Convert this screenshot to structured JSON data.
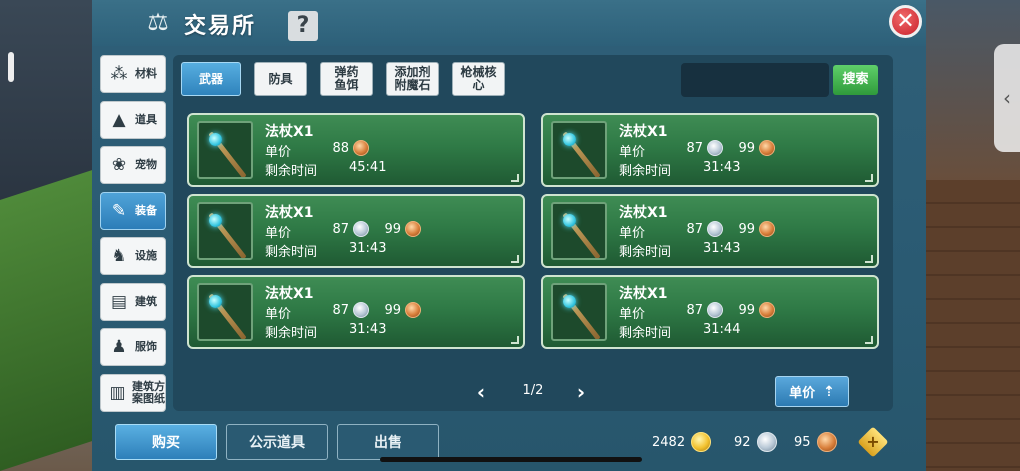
{
  "header": {
    "title": "交易所",
    "help_label": "?",
    "close_label": "✕"
  },
  "categories": [
    {
      "label": "材料",
      "icon": "ore-icon",
      "glyph": "⁂",
      "active": false
    },
    {
      "label": "道具",
      "icon": "potion-icon",
      "glyph": "▲",
      "active": false
    },
    {
      "label": "宠物",
      "icon": "paw-icon",
      "glyph": "❀",
      "active": false
    },
    {
      "label": "装备",
      "icon": "equipment-icon",
      "glyph": "✎",
      "active": true
    },
    {
      "label": "设施",
      "icon": "facility-icon",
      "glyph": "♞",
      "active": false
    },
    {
      "label": "建筑",
      "icon": "building-icon",
      "glyph": "▤",
      "active": false
    },
    {
      "label": "服饰",
      "icon": "clothing-icon",
      "glyph": "♟",
      "active": false
    },
    {
      "label": "建筑方\n案图纸",
      "icon": "blueprint-icon",
      "glyph": "▥",
      "active": false
    }
  ],
  "tabs": [
    {
      "label": "武器",
      "active": true
    },
    {
      "label": "防具",
      "active": false
    },
    {
      "label": "弹药\n鱼饵",
      "active": false
    },
    {
      "label": "添加剂\n附魔石",
      "active": false
    },
    {
      "label": "枪械核\n心",
      "active": false
    }
  ],
  "search": {
    "value": "",
    "button_label": "搜索"
  },
  "listings": [
    {
      "name": "法杖X1",
      "price_label": "单价",
      "silver": "88",
      "copper": "",
      "time_label": "剩余时间",
      "time": "45:41"
    },
    {
      "name": "法杖X1",
      "price_label": "单价",
      "silver": "87",
      "copper": "99",
      "time_label": "剩余时间",
      "time": "31:43"
    },
    {
      "name": "法杖X1",
      "price_label": "单价",
      "silver": "87",
      "copper": "99",
      "time_label": "剩余时间",
      "time": "31:43"
    },
    {
      "name": "法杖X1",
      "price_label": "单价",
      "silver": "87",
      "copper": "99",
      "time_label": "剩余时间",
      "time": "31:43"
    },
    {
      "name": "法杖X1",
      "price_label": "单价",
      "silver": "87",
      "copper": "99",
      "time_label": "剩余时间",
      "time": "31:43"
    },
    {
      "name": "法杖X1",
      "price_label": "单价",
      "silver": "87",
      "copper": "99",
      "time_label": "剩余时间",
      "time": "31:44"
    }
  ],
  "pager": {
    "text": "1/2",
    "prev": "‹",
    "next": "›"
  },
  "sort": {
    "label": "单价",
    "arrow": "⇡"
  },
  "bottom": {
    "buy_label": "购买",
    "public_label": "公示道具",
    "sell_label": "出售",
    "gold": "2482",
    "silver": "92",
    "copper": "95",
    "plus": "+"
  }
}
